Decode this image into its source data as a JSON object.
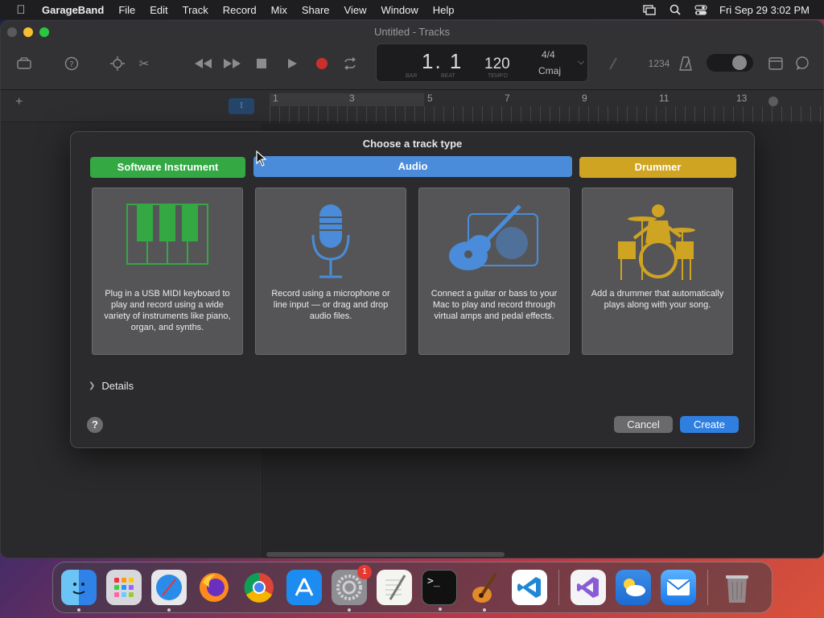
{
  "menubar": {
    "app": "GarageBand",
    "items": [
      "File",
      "Edit",
      "Track",
      "Record",
      "Mix",
      "Share",
      "View",
      "Window",
      "Help"
    ],
    "clock": "Fri Sep 29  3:02 PM"
  },
  "window": {
    "title": "Untitled - Tracks"
  },
  "lcd": {
    "bar": "1. 1",
    "bar_label": "BAR",
    "beat_label": "BEAT",
    "tempo": "120",
    "tempo_label": "TEMPO",
    "signature": "4/4",
    "key": "Cmaj"
  },
  "toolbar": {
    "count_in": "1234"
  },
  "ruler": {
    "marks": [
      "1",
      "3",
      "5",
      "7",
      "9",
      "11",
      "13"
    ]
  },
  "dialog": {
    "title": "Choose a track type",
    "types": [
      {
        "label": "Software Instrument",
        "description": "Plug in a USB MIDI keyboard to play and record using a wide variety of instruments like piano, organ, and synths."
      },
      {
        "label": "Audio",
        "description": "Record using a microphone or line input — or drag and drop audio files."
      },
      {
        "label": "",
        "description": "Connect a guitar or bass to your Mac to play and record through virtual amps and pedal effects."
      },
      {
        "label": "Drummer",
        "description": "Add a drummer that automatically plays along with your song."
      }
    ],
    "details": "Details",
    "help": "?",
    "cancel": "Cancel",
    "create": "Create"
  },
  "dock": {
    "settings_badge": "1"
  },
  "colors": {
    "software_instrument": "#33a843",
    "audio": "#4a8cd9",
    "drummer": "#cfa422",
    "primary_button": "#2f7fe0"
  }
}
